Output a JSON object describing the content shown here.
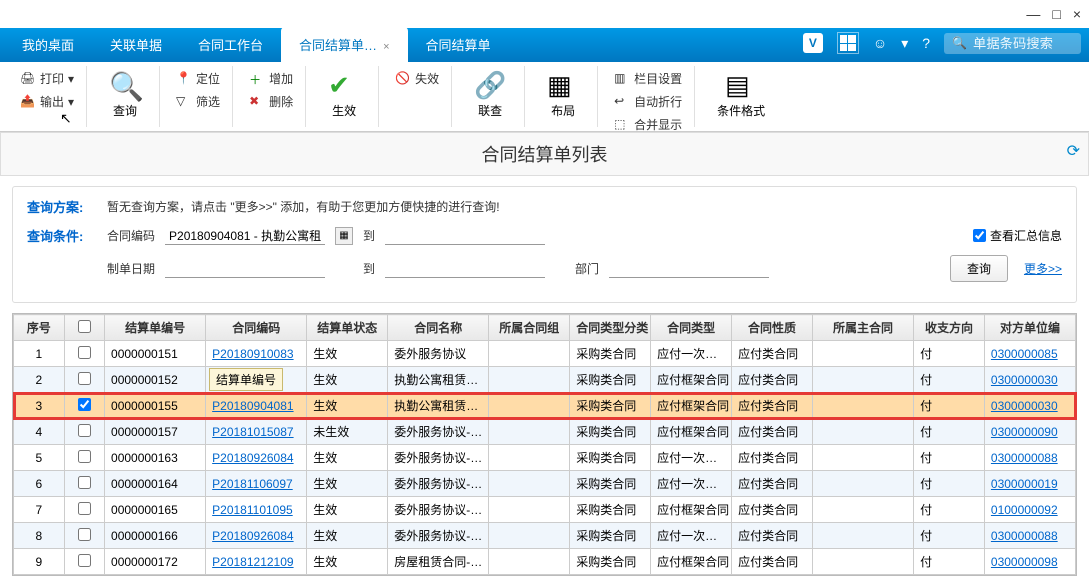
{
  "window": {
    "min": "—",
    "max": "□",
    "close": "×"
  },
  "tabs": {
    "items": [
      "我的桌面",
      "关联单据",
      "合同工作台",
      "合同结算单…",
      "合同结算单"
    ],
    "activeIndex": 3
  },
  "topbar": {
    "smiley": "☺",
    "search_placeholder": "单据条码搜索"
  },
  "toolbar": {
    "print": "打印",
    "export": "输出",
    "query": "查询",
    "locate": "定位",
    "filter": "筛选",
    "add": "增加",
    "delete": "删除",
    "effect": "生效",
    "void": "失效",
    "link": "联查",
    "layout": "布局",
    "colset": "栏目设置",
    "autowrap": "自动折行",
    "merge": "合并显示",
    "condfmt": "条件格式"
  },
  "header": {
    "title": "合同结算单列表"
  },
  "query": {
    "scheme_label": "查询方案:",
    "scheme_text": "暂无查询方案，请点击 \"更多>>\" 添加，有助于您更加方便快捷的进行查询!",
    "cond_label": "查询条件:",
    "contract_code_label": "合同编码",
    "contract_code_value": "P20180904081 - 执勤公寓租",
    "to": "到",
    "date_label": "制单日期",
    "dept_label": "部门",
    "summary_label": "查看汇总信息",
    "query_btn": "查询",
    "more": "更多>>",
    "tooltip": "结算单编号"
  },
  "columns": {
    "seq": "序号",
    "chk": "",
    "settle_no": "结算单编号",
    "code": "合同编码",
    "status": "结算单状态",
    "name": "合同名称",
    "group": "所属合同组",
    "cat": "合同类型分类",
    "type": "合同类型",
    "nature": "合同性质",
    "main": "所属主合同",
    "dir": "收支方向",
    "party": "对方单位编"
  },
  "rows": [
    {
      "seq": "1",
      "chk": false,
      "no": "0000000151",
      "code": "P20180910083",
      "status": "生效",
      "name": "委外服务协议",
      "cat": "采购类合同",
      "type": "应付一次…",
      "nature": "应付类合同",
      "dir": "付",
      "party": "0300000085"
    },
    {
      "seq": "2",
      "chk": false,
      "no": "0000000152",
      "code": "4081",
      "code_full": "P20180904081",
      "status": "生效",
      "name": "执勤公寓租赁…",
      "cat": "采购类合同",
      "type": "应付框架合同",
      "nature": "应付类合同",
      "dir": "付",
      "party": "0300000030"
    },
    {
      "seq": "3",
      "chk": true,
      "no": "0000000155",
      "code": "P20180904081",
      "status": "生效",
      "name": "执勤公寓租赁…",
      "cat": "采购类合同",
      "type": "应付框架合同",
      "nature": "应付类合同",
      "dir": "付",
      "party": "0300000030",
      "hl": true
    },
    {
      "seq": "4",
      "chk": false,
      "no": "0000000157",
      "code": "P20181015087",
      "status": "未生效",
      "name": "委外服务协议-…",
      "cat": "采购类合同",
      "type": "应付框架合同",
      "nature": "应付类合同",
      "dir": "付",
      "party": "0300000090"
    },
    {
      "seq": "5",
      "chk": false,
      "no": "0000000163",
      "code": "P20180926084",
      "status": "生效",
      "name": "委外服务协议-…",
      "cat": "采购类合同",
      "type": "应付一次…",
      "nature": "应付类合同",
      "dir": "付",
      "party": "0300000088"
    },
    {
      "seq": "6",
      "chk": false,
      "no": "0000000164",
      "code": "P20181106097",
      "status": "生效",
      "name": "委外服务协议-…",
      "cat": "采购类合同",
      "type": "应付一次…",
      "nature": "应付类合同",
      "dir": "付",
      "party": "0300000019"
    },
    {
      "seq": "7",
      "chk": false,
      "no": "0000000165",
      "code": "P20181101095",
      "status": "生效",
      "name": "委外服务协议-…",
      "cat": "采购类合同",
      "type": "应付框架合同",
      "nature": "应付类合同",
      "dir": "付",
      "party": "0100000092"
    },
    {
      "seq": "8",
      "chk": false,
      "no": "0000000166",
      "code": "P20180926084",
      "status": "生效",
      "name": "委外服务协议-…",
      "cat": "采购类合同",
      "type": "应付一次…",
      "nature": "应付类合同",
      "dir": "付",
      "party": "0300000088"
    },
    {
      "seq": "9",
      "chk": false,
      "no": "0000000172",
      "code": "P20181212109",
      "status": "生效",
      "name": "房屋租赁合同-…",
      "cat": "采购类合同",
      "type": "应付框架合同",
      "nature": "应付类合同",
      "dir": "付",
      "party": "0300000098"
    }
  ]
}
